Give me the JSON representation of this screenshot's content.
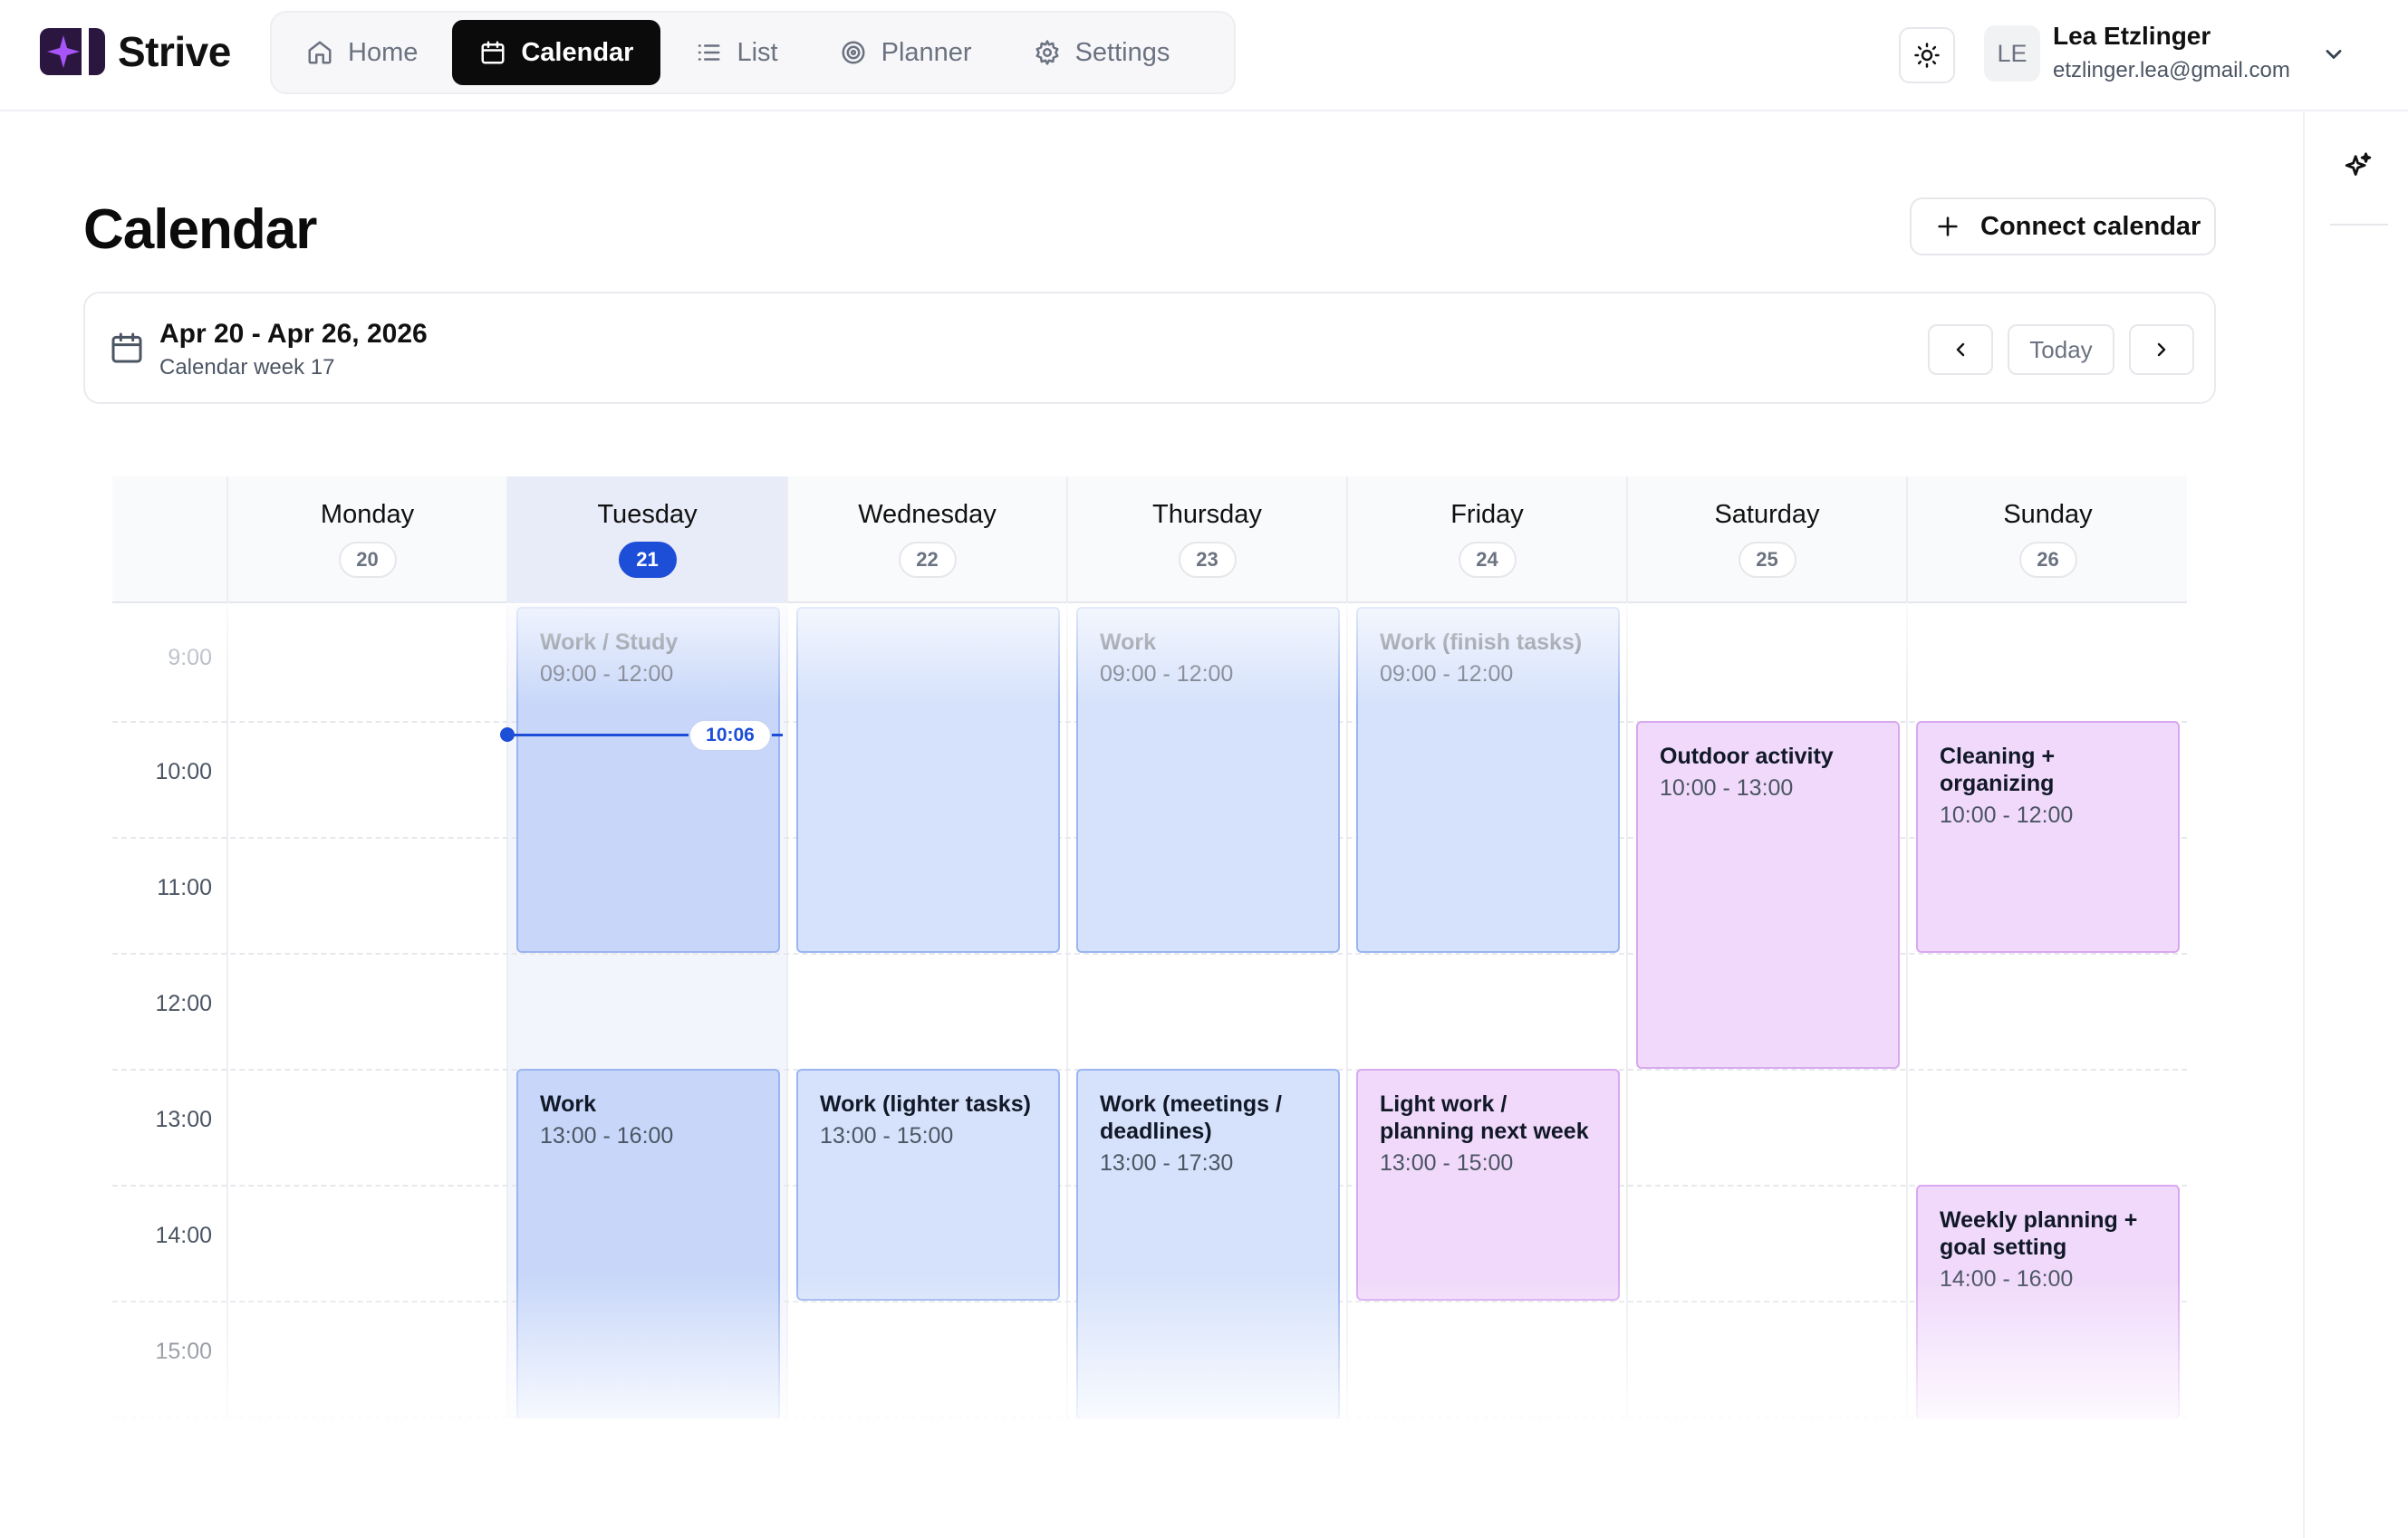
{
  "app": {
    "name": "Strive"
  },
  "nav": {
    "items": [
      {
        "label": "Home",
        "icon": "home-icon",
        "active": false
      },
      {
        "label": "Calendar",
        "icon": "calendar-icon",
        "active": true
      },
      {
        "label": "List",
        "icon": "list-icon",
        "active": false
      },
      {
        "label": "Planner",
        "icon": "target-icon",
        "active": false
      },
      {
        "label": "Settings",
        "icon": "gear-icon",
        "active": false
      }
    ]
  },
  "user": {
    "initials": "LE",
    "name": "Lea Etzlinger",
    "email": "etzlinger.lea@gmail.com"
  },
  "page": {
    "title": "Calendar",
    "connect_label": "Connect calendar",
    "week_range": "Apr 20 - Apr 26, 2026",
    "week_label": "Calendar week 17",
    "today_label": "Today"
  },
  "days": [
    {
      "name": "Monday",
      "num": "20",
      "today": false
    },
    {
      "name": "Tuesday",
      "num": "21",
      "today": true
    },
    {
      "name": "Wednesday",
      "num": "22",
      "today": false
    },
    {
      "name": "Thursday",
      "num": "23",
      "today": false
    },
    {
      "name": "Friday",
      "num": "24",
      "today": false
    },
    {
      "name": "Saturday",
      "num": "25",
      "today": false
    },
    {
      "name": "Sunday",
      "num": "26",
      "today": false
    }
  ],
  "hours": [
    "9:00",
    "10:00",
    "11:00",
    "12:00",
    "13:00",
    "14:00",
    "15:00"
  ],
  "now": {
    "label": "10:06"
  },
  "events": [
    {
      "day": "Tuesday",
      "title": "Work / Study",
      "time": "09:00 - 12:00",
      "color": "blue",
      "past": true
    },
    {
      "day": "Wednesday",
      "title": "",
      "time": "",
      "color": "blue",
      "past": false
    },
    {
      "day": "Thursday",
      "title": "Work",
      "time": "09:00 - 12:00",
      "color": "blue",
      "past": true
    },
    {
      "day": "Friday",
      "title": "Work (finish tasks)",
      "time": "09:00 - 12:00",
      "color": "blue",
      "past": true
    },
    {
      "day": "Saturday",
      "title": "Outdoor activity",
      "time": "10:00 - 13:00",
      "color": "purple",
      "past": false
    },
    {
      "day": "Sunday",
      "title": "Cleaning + organizing",
      "time": "10:00 - 12:00",
      "color": "purple",
      "past": false
    },
    {
      "day": "Tuesday",
      "title": "Work",
      "time": "13:00 - 16:00",
      "color": "blue",
      "past": false
    },
    {
      "day": "Wednesday",
      "title": "Work (lighter tasks)",
      "time": "13:00 - 15:00",
      "color": "blue",
      "past": false
    },
    {
      "day": "Thursday",
      "title": "Work (meetings / deadlines)",
      "time": "13:00 - 17:30",
      "color": "blue",
      "past": false
    },
    {
      "day": "Friday",
      "title": "Light work / planning next week",
      "time": "13:00 - 15:00",
      "color": "purple",
      "past": false
    },
    {
      "day": "Sunday",
      "title": "Weekly planning + goal setting",
      "time": "14:00 - 16:00",
      "color": "purple",
      "past": false
    }
  ],
  "colors": {
    "accent": "#1d4ed8",
    "event_blue": "#d6e2fb",
    "event_purple": "#f0d9fb",
    "logo": "#2b1640",
    "logo_star": "#a855f7"
  }
}
